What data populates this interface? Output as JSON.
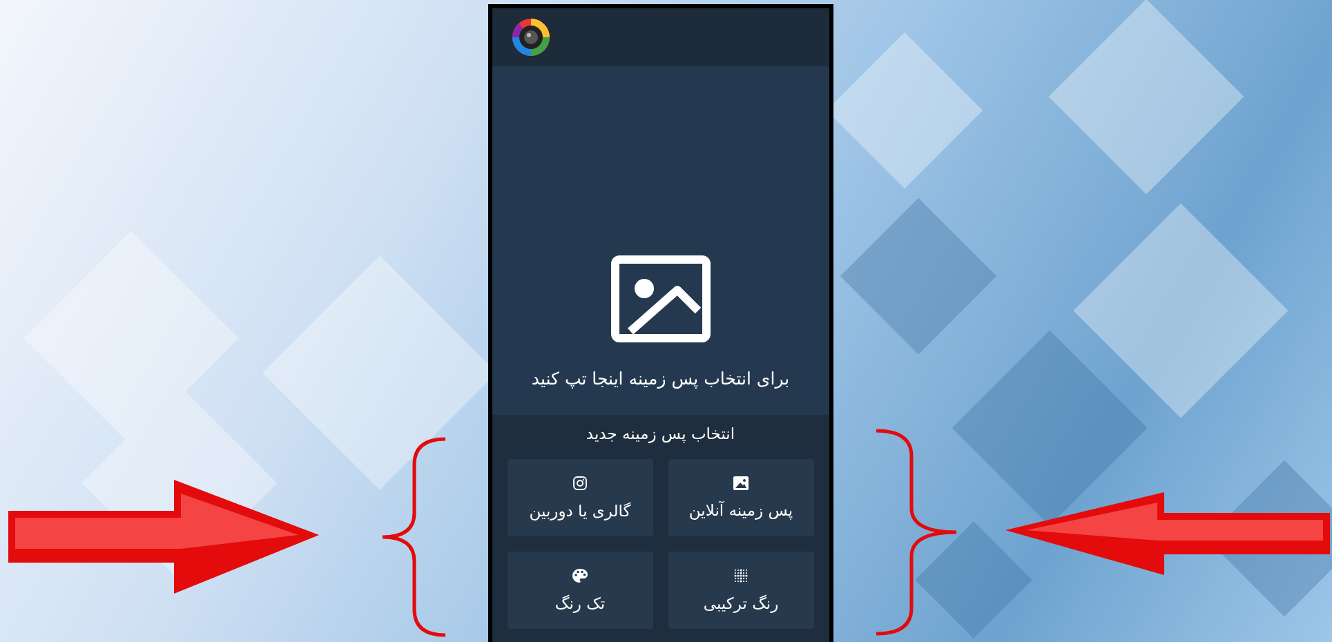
{
  "preview": {
    "hint": "برای انتخاب پس زمینه اینجا تپ کنید"
  },
  "section_title": "انتخاب پس زمینه جدید",
  "options": [
    {
      "kind": "online",
      "label": "پس زمینه آنلاین"
    },
    {
      "kind": "gallery",
      "label": "گالری یا دوربین"
    },
    {
      "kind": "gradient",
      "label": "رنگ ترکیبی"
    },
    {
      "kind": "solid",
      "label": "تک رنگ"
    }
  ]
}
